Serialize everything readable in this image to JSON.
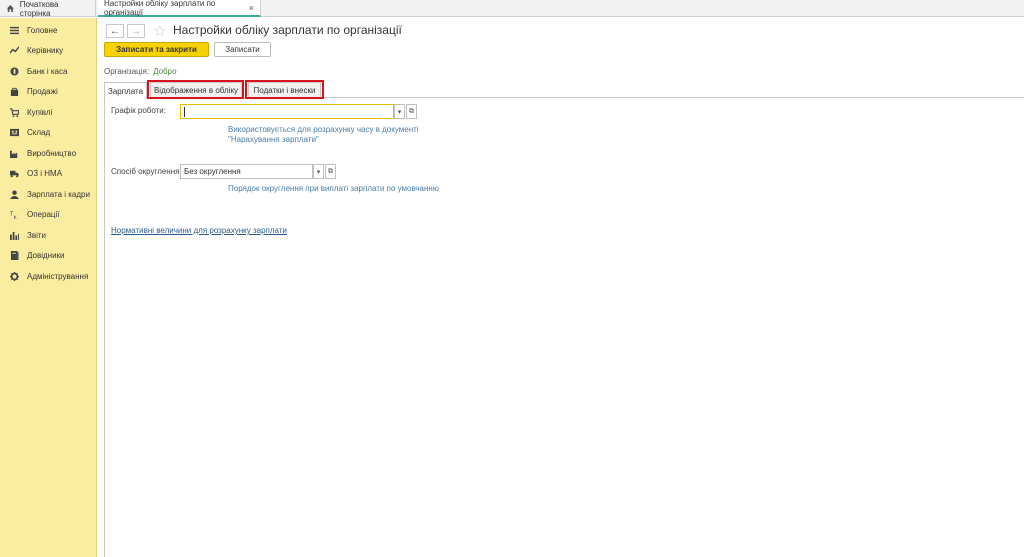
{
  "top_tabs": {
    "home": "Початкова сторінка",
    "active": "Настройки обліку зарплати по організації",
    "close": "×"
  },
  "sidebar": {
    "items": [
      {
        "label": "Головне",
        "icon": "menu-icon"
      },
      {
        "label": "Керівнику",
        "icon": "trend-icon"
      },
      {
        "label": "Банк і каса",
        "icon": "coin-icon"
      },
      {
        "label": "Продажі",
        "icon": "bag-icon"
      },
      {
        "label": "Купівлі",
        "icon": "cart-icon"
      },
      {
        "label": "Склад",
        "icon": "warehouse-icon"
      },
      {
        "label": "Виробництво",
        "icon": "factory-icon"
      },
      {
        "label": "ОЗ і НМА",
        "icon": "truck-icon"
      },
      {
        "label": "Зарплата і кадри",
        "icon": "person-icon"
      },
      {
        "label": "Операції",
        "icon": "operations-icon"
      },
      {
        "label": "Звіти",
        "icon": "chart-icon"
      },
      {
        "label": "Довідники",
        "icon": "book-icon"
      },
      {
        "label": "Адміністрування",
        "icon": "gear-icon"
      }
    ]
  },
  "header": {
    "back": "←",
    "forward": "→",
    "star": "☆",
    "title": "Настройки обліку зарплати по організації"
  },
  "toolbar": {
    "save_close": "Записати та закрити",
    "save": "Записати"
  },
  "organization": {
    "label": "Організація:",
    "value": "Добро"
  },
  "form_tabs": [
    "Зарплата",
    "Відображення в обліку",
    "Податки і внески"
  ],
  "form": {
    "schedule_label": "Графік роботи:",
    "schedule_value": "",
    "schedule_hint_1": "Використовується для розрахунку часу в документі",
    "schedule_hint_2": "\"Нарахування зарплати\"",
    "rounding_label": "Спосіб округлення:",
    "rounding_value": "Без округлення",
    "rounding_hint": "Порядок округлення при виплаті зарплати по умовчанню",
    "norm_link": "Нормативні величини для розрахунку зарплати"
  },
  "colors": {
    "sidebar_bg": "#fbeda0",
    "primary_button": "#f5d200",
    "highlight": "#d9121e",
    "link": "#2a5c8a"
  }
}
